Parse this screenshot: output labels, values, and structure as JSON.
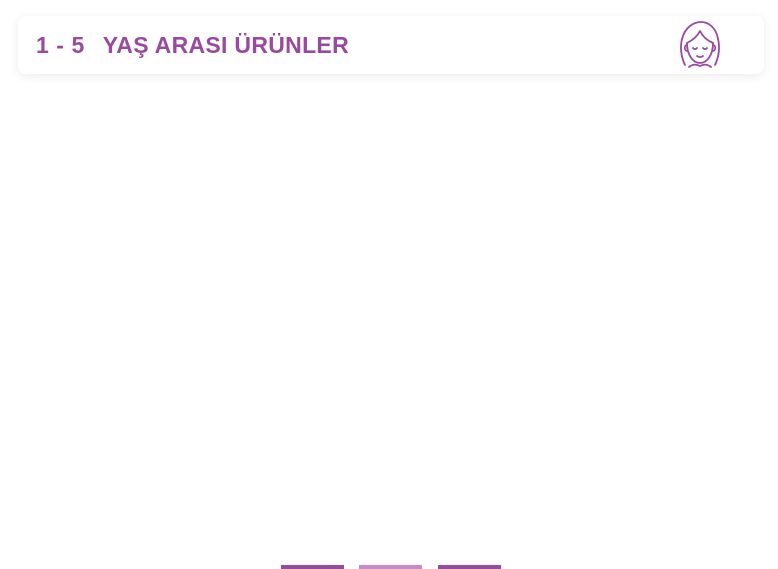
{
  "header": {
    "range_from": "1",
    "range_sep": "-",
    "range_to": "5",
    "title": "YAŞ ARASI ÜRÜNLER",
    "avatar_icon": "girl-face-icon"
  },
  "carousel": {
    "active_index": 2,
    "dots": [
      {
        "color": "#9a4a9e"
      },
      {
        "color": "#c98ac9"
      },
      {
        "color": "#9a4a9e"
      }
    ]
  },
  "colors": {
    "accent": "#9a4a9e",
    "accent_light": "#c98ac9",
    "background": "#ffffff"
  }
}
